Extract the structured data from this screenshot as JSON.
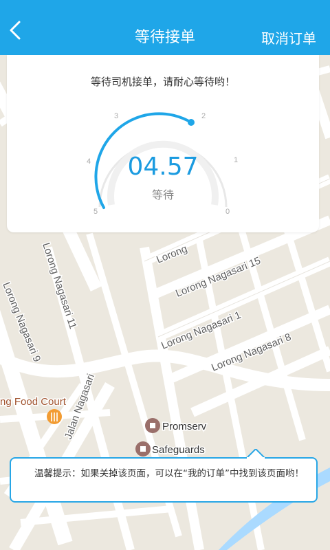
{
  "header": {
    "title": "等待接单",
    "cancel_label": "取消订单"
  },
  "card": {
    "message": "等待司机接单，请耐心等待哟！",
    "timer": "04.57",
    "timer_label": "等待",
    "ticks": [
      "5",
      "4",
      "3",
      "2",
      "1",
      "0"
    ]
  },
  "map": {
    "streets": [
      "Lorong Nagasari 15",
      "Lorong Nagasari 1",
      "Lorong Nagasari 8",
      "Lorong Nagasari 11",
      "Lorong Nagasari 9",
      "Jalan Nagasari",
      "Lorong"
    ],
    "places": {
      "food_court": "ng Food Court",
      "promserv": "Promserv",
      "safeguards": "Safeguards"
    }
  },
  "tip": {
    "text": "温馨提示：如果关掉该页面，可以在“我的订单”中找到该页面哟！"
  },
  "colors": {
    "accent": "#1fa6e8",
    "map_bg": "#ece8df",
    "road": "#ffffff",
    "water": "#aadaff",
    "poi_pin": "#9a6f6a"
  }
}
